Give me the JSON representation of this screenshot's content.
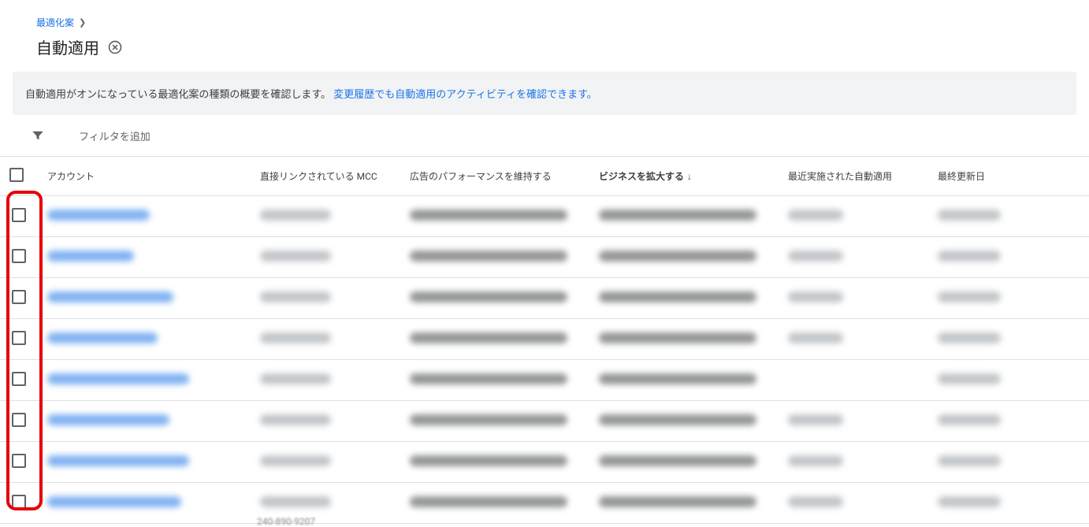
{
  "breadcrumb": {
    "parent": "最適化案"
  },
  "page": {
    "title": "自動適用"
  },
  "info": {
    "text": "自動適用がオンになっている最適化案の種類の概要を確認します。",
    "link": "変更履歴でも自動適用のアクティビティを確認できます。"
  },
  "filter": {
    "add_label": "フィルタを追加"
  },
  "columns": {
    "account": "アカウント",
    "mcc": "直接リンクされている MCC",
    "perf": "広告のパフォーマンスを維持する",
    "grow": "ビジネスを拡大する",
    "recent": "最近実施された自動適用",
    "updated": "最終更新日"
  },
  "sort": {
    "column": "grow",
    "direction": "desc",
    "arrow": "↓"
  },
  "rows": [
    {
      "account_w": 130,
      "mcc_w": 90,
      "perf_w": 200,
      "grow_w": 200,
      "recent_w": 70,
      "updated_w": 80
    },
    {
      "account_w": 110,
      "mcc_w": 90,
      "perf_w": 200,
      "grow_w": 200,
      "recent_w": 70,
      "updated_w": 80
    },
    {
      "account_w": 160,
      "mcc_w": 90,
      "perf_w": 200,
      "grow_w": 200,
      "recent_w": 70,
      "updated_w": 80
    },
    {
      "account_w": 140,
      "mcc_w": 90,
      "perf_w": 200,
      "grow_w": 200,
      "recent_w": 70,
      "updated_w": 80
    },
    {
      "account_w": 180,
      "mcc_w": 90,
      "perf_w": 200,
      "grow_w": 200,
      "recent_w": 0,
      "updated_w": 80
    },
    {
      "account_w": 155,
      "mcc_w": 90,
      "perf_w": 200,
      "grow_w": 200,
      "recent_w": 70,
      "updated_w": 80
    },
    {
      "account_w": 180,
      "mcc_w": 90,
      "perf_w": 200,
      "grow_w": 200,
      "recent_w": 70,
      "updated_w": 80
    },
    {
      "account_w": 170,
      "mcc_w": 90,
      "perf_w": 200,
      "grow_w": 200,
      "recent_w": 70,
      "updated_w": 80
    }
  ],
  "footer_number": "240-890-9207"
}
